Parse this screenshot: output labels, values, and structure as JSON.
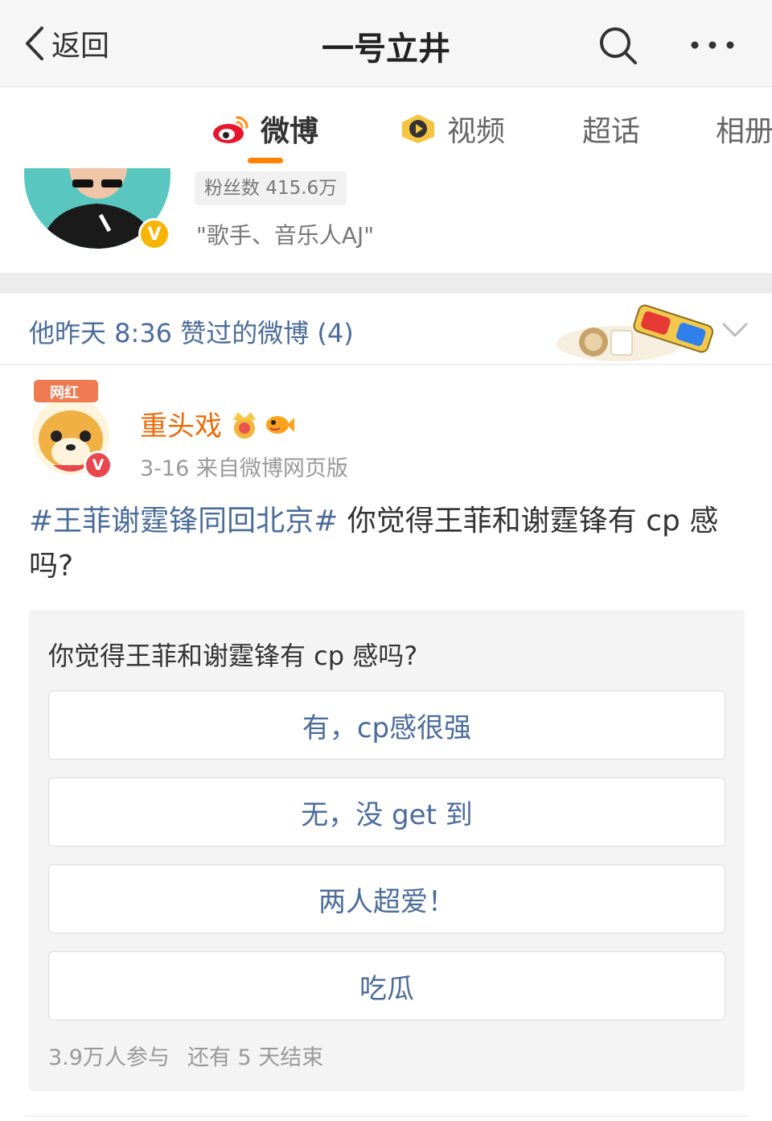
{
  "navbar": {
    "back_label": "返回",
    "title": "一号立井",
    "search_icon": "search-icon",
    "more_icon": "more-icon"
  },
  "tabs": [
    {
      "label": "微博",
      "icon": "weibo-logo-icon",
      "active": true
    },
    {
      "label": "视频",
      "icon": "video-play-icon",
      "active": false
    },
    {
      "label": "超话",
      "active": false
    },
    {
      "label": "相册",
      "active": false
    }
  ],
  "profile": {
    "fans": "粉丝数 415.6万",
    "bio": "\"歌手、音乐人AJ\"",
    "verified_badge": "V"
  },
  "liked": {
    "text": "他昨天 8:36 赞过的微博 (4)"
  },
  "post": {
    "avatar_tag": "网红",
    "author": "重头戏",
    "verified_badge": "V",
    "meta": "3-16  来自微博网页版",
    "hashtag": "#王菲谢霆锋同回北京#",
    "text": " 你觉得王菲和谢霆锋有 cp 感吗?",
    "vote": {
      "question": "你觉得王菲和谢霆锋有 cp 感吗?",
      "options": [
        "有，cp感很强",
        "无，没 get 到",
        "两人超爱！",
        "吃瓜"
      ],
      "participants": "3.9万人参与",
      "remaining": "还有 5 天结束"
    }
  },
  "colors": {
    "accent": "#ff8200",
    "link": "#4c6c9a",
    "author": "#e86b0a",
    "verified": "#f7b500"
  }
}
